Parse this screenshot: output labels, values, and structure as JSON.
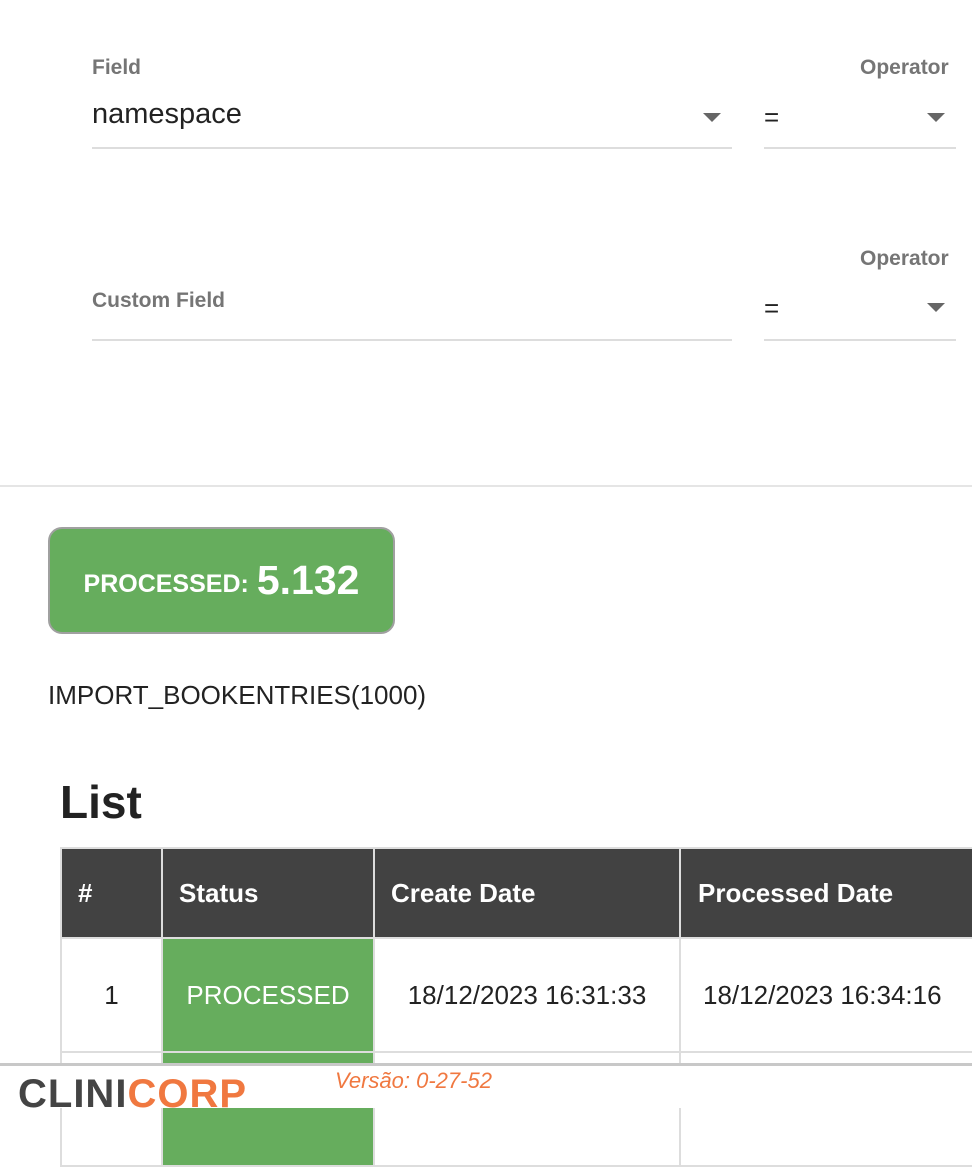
{
  "filters": [
    {
      "label": "Field",
      "value": "namespace",
      "operator_label": "Operator",
      "operator_value": "="
    },
    {
      "placeholder": "Custom Field",
      "operator_label": "Operator",
      "operator_value": "="
    }
  ],
  "summary": {
    "status": "PROCESSED:",
    "count": "5.132",
    "color": "#66ad5d"
  },
  "job": "IMPORT_BOOKENTRIES(1000)",
  "list": {
    "title": "List",
    "columns": [
      "#",
      "Status",
      "Create Date",
      "Processed Date"
    ],
    "rows": [
      {
        "n": "1",
        "status": "PROCESSED",
        "created": "18/12/2023 16:31:33",
        "processed": "18/12/2023 16:34:16"
      }
    ]
  },
  "footer": {
    "logo_a": "CLINI",
    "logo_b": "CORP",
    "version": "Versão: 0-27-52"
  }
}
